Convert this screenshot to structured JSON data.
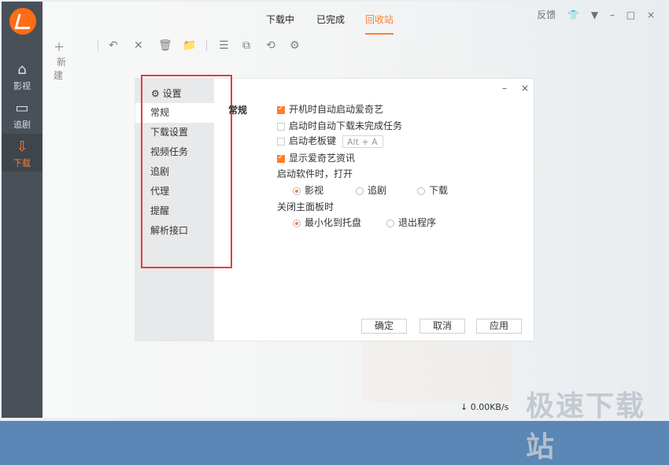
{
  "app": {
    "title": "爱奇艺",
    "colors": {
      "accent": "#ff7e2d",
      "nav": "#4a5058",
      "highlight": "#e53d3d"
    }
  },
  "nav": [
    {
      "label": "影视",
      "icon": "home-icon"
    },
    {
      "label": "追剧",
      "icon": "tv-icon"
    },
    {
      "label": "下载",
      "icon": "download-icon"
    }
  ],
  "tabs": [
    "下载中",
    "已完成",
    "回收站"
  ],
  "header_actions": [
    "反馈",
    "衣服",
    "▼",
    "–",
    "□",
    "×"
  ],
  "toolbar": {
    "new_label": "新建",
    "icons": [
      "plus-icon",
      "undo-icon",
      "close-icon",
      "trash-icon",
      "folder-icon",
      "list-icon",
      "copy-icon",
      "refresh-icon",
      "gear-icon"
    ]
  },
  "status": {
    "speed": "↓ 0.00KB/s",
    "watermark": "极速下载站"
  },
  "dialog": {
    "title": "设置",
    "controls": [
      "–",
      "×"
    ],
    "sidebar": [
      "常规",
      "下载设置",
      "视频任务",
      "追剧",
      "代理",
      "提醒",
      "解析接口"
    ],
    "content_title": "常规",
    "options": [
      {
        "label": "开机时自动启动爱奇艺",
        "checked": true
      },
      {
        "label": "启动时自动下载未完成任务",
        "checked": false
      },
      {
        "label": "启动老板键",
        "checked": false,
        "hotkey": "Alt + A"
      },
      {
        "label": "显示爱奇艺资讯",
        "checked": true
      }
    ],
    "startup_label": "启动软件时，打开",
    "startup_options": [
      {
        "label": "影视",
        "selected": true
      },
      {
        "label": "追剧",
        "selected": false
      },
      {
        "label": "下载",
        "selected": false
      }
    ],
    "close_label": "关闭主面板时",
    "close_options": [
      {
        "label": "最小化到托盘",
        "selected": true
      },
      {
        "label": "退出程序",
        "selected": false
      }
    ],
    "buttons": [
      "确定",
      "取消",
      "应用"
    ]
  }
}
